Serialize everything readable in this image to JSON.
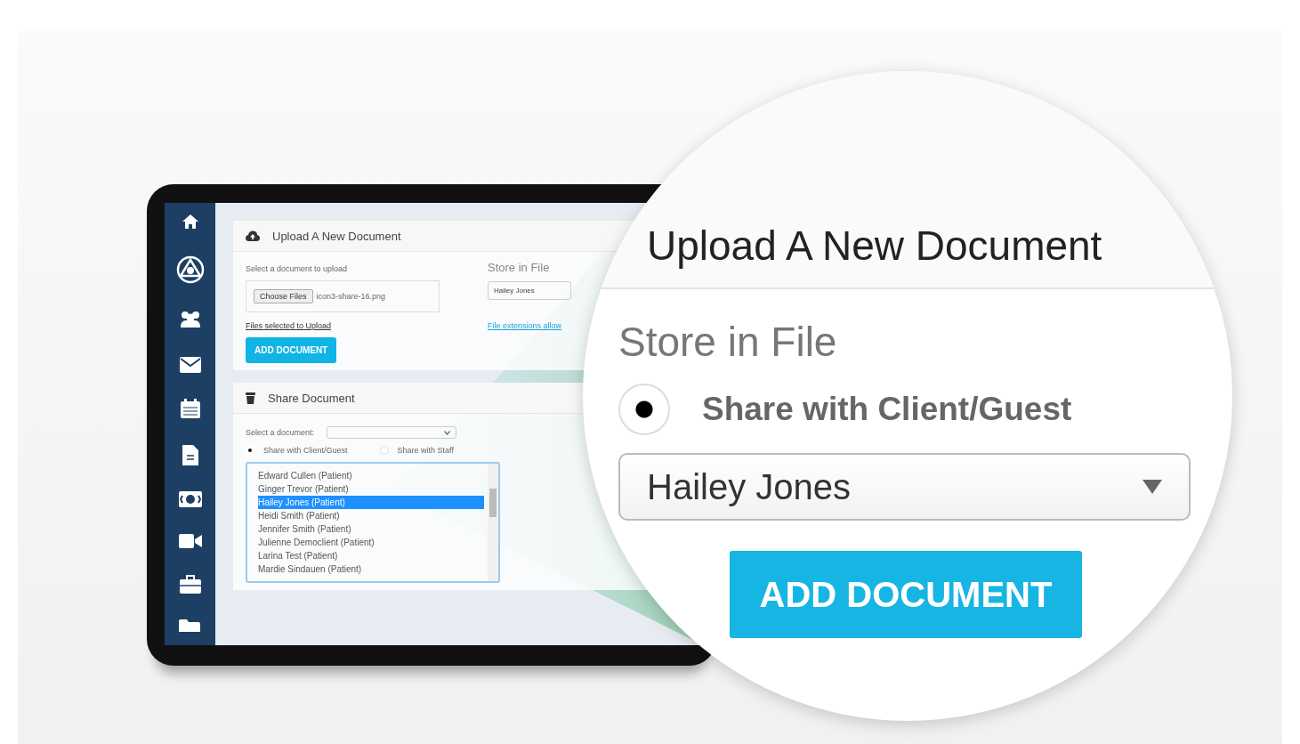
{
  "upload_panel": {
    "title": "Upload A New Document",
    "select_label": "Select a document to upload",
    "file_button": "Choose Files",
    "file_name": "icon3-share-16.png",
    "files_selected_link": "Files selected to Upload",
    "store_label": "Store in File",
    "store_value": "Hailey Jones",
    "extensions_link": "File extensions allow",
    "add_button": "ADD DOCUMENT"
  },
  "share_panel": {
    "title": "Share Document",
    "select_label": "Select a document:",
    "radios": [
      {
        "label": "Share with Client/Guest",
        "selected": true
      },
      {
        "label": "Share with Staff",
        "selected": false
      }
    ],
    "recipients": [
      {
        "label": "Edward Cullen (Patient)",
        "selected": false
      },
      {
        "label": "Ginger Trevor (Patient)",
        "selected": false
      },
      {
        "label": "Hailey Jones (Patient)",
        "selected": true
      },
      {
        "label": "Heidi Smith (Patient)",
        "selected": false
      },
      {
        "label": "Jennifer Smith (Patient)",
        "selected": false
      },
      {
        "label": "Julienne Democlient (Patient)",
        "selected": false
      },
      {
        "label": "Larina Test (Patient)",
        "selected": false
      },
      {
        "label": "Mardie Sindauen (Patient)",
        "selected": false
      }
    ]
  },
  "magnifier": {
    "title": "Upload A New Document",
    "store_label": "Store in File",
    "radio": {
      "label": "Share with Client/Guest",
      "selected": true
    },
    "select_value": "Hailey Jones",
    "button": "ADD DOCUMENT"
  }
}
